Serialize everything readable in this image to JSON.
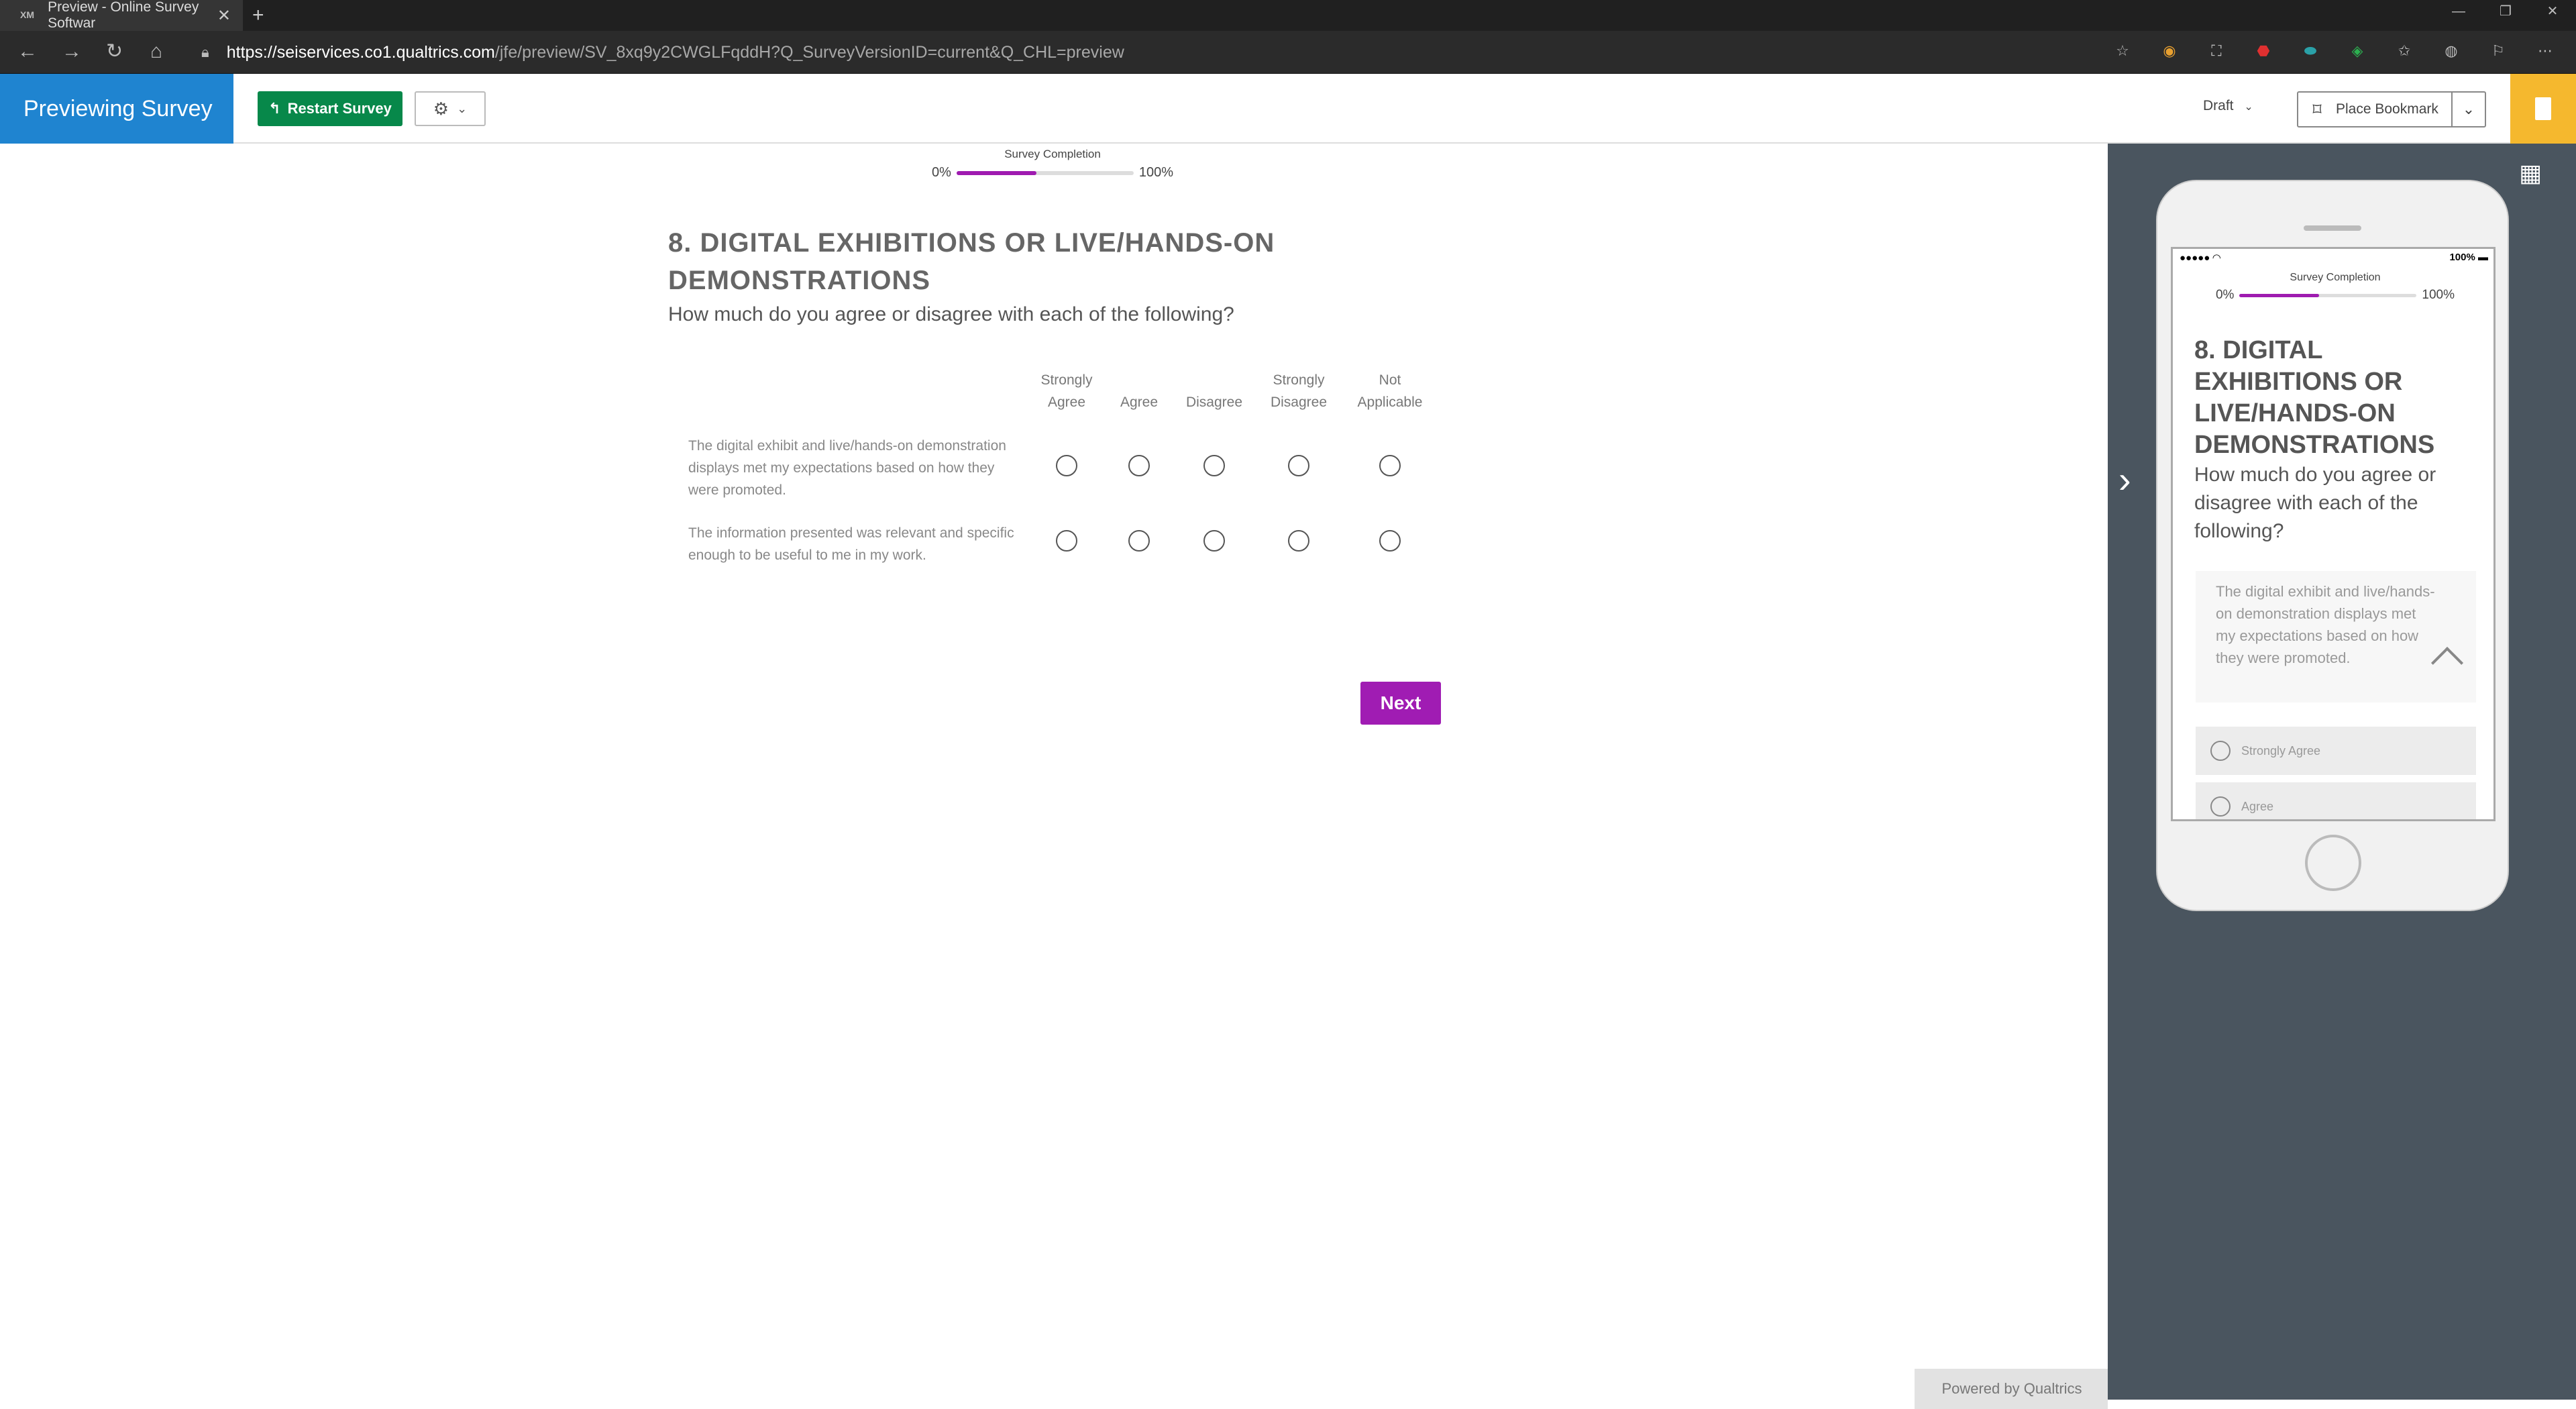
{
  "browser": {
    "tab_title": "Preview - Online Survey Softwar",
    "tab_favicon": "XM",
    "url_host": "https://seiservices.co1.qualtrics.com",
    "url_path": "/jfe/preview/SV_8xq9y2CWGLFqddH?Q_SurveyVersionID=current&Q_CHL=preview"
  },
  "header": {
    "brand": "Previewing Survey",
    "restart_label": "Restart Survey",
    "draft_label": "Draft",
    "bookmark_label": "Place Bookmark"
  },
  "survey": {
    "progress_label": "Survey Completion",
    "progress_min": "0%",
    "progress_max": "100%",
    "progress_value": 0.45,
    "question_title": "8. DIGITAL EXHIBITIONS OR LIVE/HANDS-ON DEMONSTRATIONS",
    "question_text": "How much do you agree or disagree with each of the following?",
    "columns": [
      {
        "line1": "Strongly",
        "line2": "Agree"
      },
      {
        "line1": "",
        "line2": "Agree"
      },
      {
        "line1": "",
        "line2": "Disagree"
      },
      {
        "line1": "Strongly",
        "line2": "Disagree"
      },
      {
        "line1": "Not",
        "line2": "Applicable"
      }
    ],
    "rows": [
      {
        "text": "The digital exhibit and live/hands-on demonstration displays met my expectations based on how they were promoted."
      },
      {
        "text": "The information presented was relevant and specific enough to be useful to me in my work."
      }
    ],
    "next_label": "Next",
    "powered_by": "Powered by Qualtrics"
  },
  "mobile": {
    "signal": "●●●●● ◠",
    "battery": "100% ▬",
    "progress_label": "Survey Completion",
    "progress_min": "0%",
    "progress_max": "100%",
    "question_title": "8. DIGITAL EXHIBITIONS OR LIVE/HANDS-ON DEMONSTRATIONS",
    "question_text": "How much do you agree or disagree with each of the following?",
    "statement": "The digital exhibit and live/hands-on demonstration displays met my expectations based on how they were promoted.",
    "options": [
      "Strongly Agree",
      "Agree"
    ]
  },
  "colors": {
    "brand_blue": "#1f84d0",
    "restart_green": "#07884a",
    "accent_purple": "#a01cb3",
    "panel_gray": "#4a555f",
    "yellow": "#f5b82e"
  }
}
